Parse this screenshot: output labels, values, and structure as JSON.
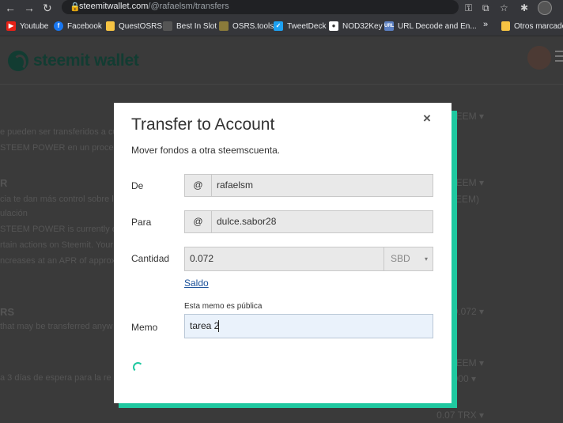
{
  "browser": {
    "url_host": "steemitwallet.com",
    "url_path": "/@rafaelsm/transfers",
    "bookmarks": [
      {
        "label": "Youtube",
        "icon": "youtube-icon",
        "color": "#e62117"
      },
      {
        "label": "Facebook",
        "icon": "facebook-icon",
        "color": "#1877f2"
      },
      {
        "label": "QuestOSRS",
        "icon": "folder-icon",
        "color": "#f6c343"
      },
      {
        "label": "Best In Slot",
        "icon": "page-icon",
        "color": "#666666"
      },
      {
        "label": "OSRS.tools",
        "icon": "osrs-icon",
        "color": "#8a7a3a"
      },
      {
        "label": "TweetDeck",
        "icon": "tweetdeck-icon",
        "color": "#1da1f2"
      },
      {
        "label": "NOD32Key",
        "icon": "key-icon",
        "color": "#ffffff"
      },
      {
        "label": "URL Decode and En...",
        "icon": "url-icon",
        "color": "#5b7fc1"
      },
      {
        "label": "Otros marcadores",
        "icon": "folder-icon",
        "color": "#f6c343"
      }
    ],
    "more": "»"
  },
  "page": {
    "logo_text": "steemit wallet",
    "bg_lines": [
      "e pueden ser transferidos a cual",
      "STEEM POWER en un proceso",
      "R",
      "cia te dan más control sobre la",
      "ulación",
      "STEEM POWER is currently de",
      "rtain actions on Steemit. Your",
      "ncreases at an APR of approx",
      "RS",
      "that may be transferred anyw",
      "a 3 días de espera para la re"
    ],
    "bg_right": [
      "TEEM ▾",
      "TEEM ▾",
      "EEM)",
      "0.072 ▾",
      "TEEM ▾",
      "1.000 ▾",
      "0.07 TRX ▾"
    ]
  },
  "modal": {
    "title": "Transfer to Account",
    "subtitle": "Mover fondos a otra steemscuenta.",
    "close": "×",
    "from_label": "De",
    "at_symbol": "@",
    "from_value": "rafaelsm",
    "to_label": "Para",
    "to_value": "dulce.sabor28",
    "amount_label": "Cantidad",
    "amount_value": "0.072",
    "asset": "SBD",
    "asset_chevron": "▾",
    "balance_link": "Saldo",
    "memo_hint": "Esta memo es pública",
    "memo_label": "Memo",
    "memo_value": "tarea 2"
  }
}
